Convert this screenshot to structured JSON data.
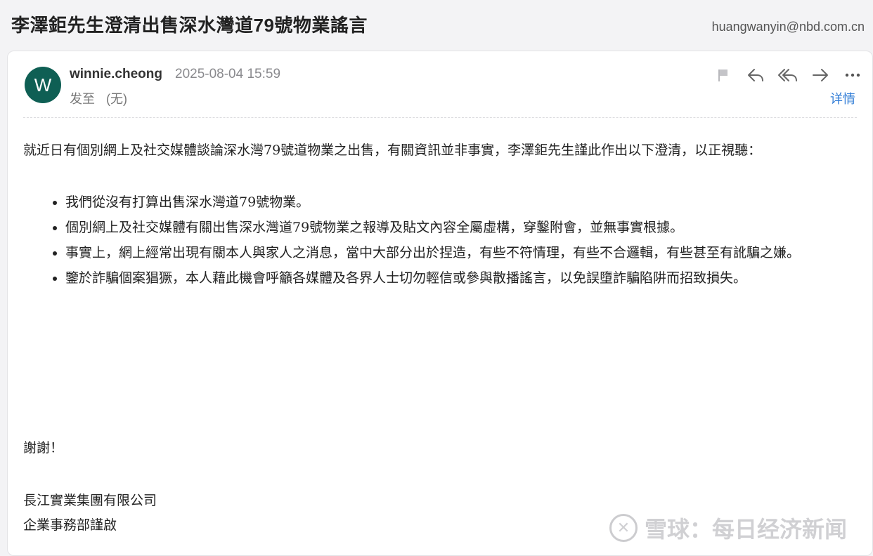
{
  "header": {
    "subject": "李澤鉅先生澄清出售深水灣道79號物業謠言",
    "account": "huangwanyin@nbd.com.cn"
  },
  "message": {
    "avatar_letter": "W",
    "sender": "winnie.cheong",
    "datetime": "2025-08-04 15:59",
    "to_label": "发至",
    "to_value": "(无)",
    "details_label": "详情",
    "actions": [
      "flag-icon",
      "reply-icon",
      "reply-all-icon",
      "forward-icon",
      "more-icon"
    ]
  },
  "body": {
    "intro": "就近日有個別網上及社交媒體談論深水灣79號道物業之出售，有關資訊並非事實，李澤鉅先生謹此作出以下澄清，以正視聽：",
    "points": [
      "我們從沒有打算出售深水灣道79號物業。",
      "個別網上及社交媒體有關出售深水灣道79號物業之報導及貼文內容全屬虛構，穿鑿附會，並無事實根據。",
      "事實上，網上經常出現有關本人與家人之消息，當中大部分出於捏造，有些不符情理，有些不合邏輯，有些甚至有訛騙之嫌。",
      "鑒於詐騙個案猖獗，本人藉此機會呼籲各媒體及各界人士切勿輕信或參與散播謠言，以免誤墮詐騙陷阱而招致損失。"
    ],
    "thanks": "謝謝！",
    "signature_company": "長江實業集團有限公司",
    "signature_dept": "企業事務部謹啟"
  },
  "watermark": {
    "text": "雪球：每日经济新闻"
  },
  "colors": {
    "avatar": "#0f5f54",
    "link": "#2f7cd6"
  }
}
